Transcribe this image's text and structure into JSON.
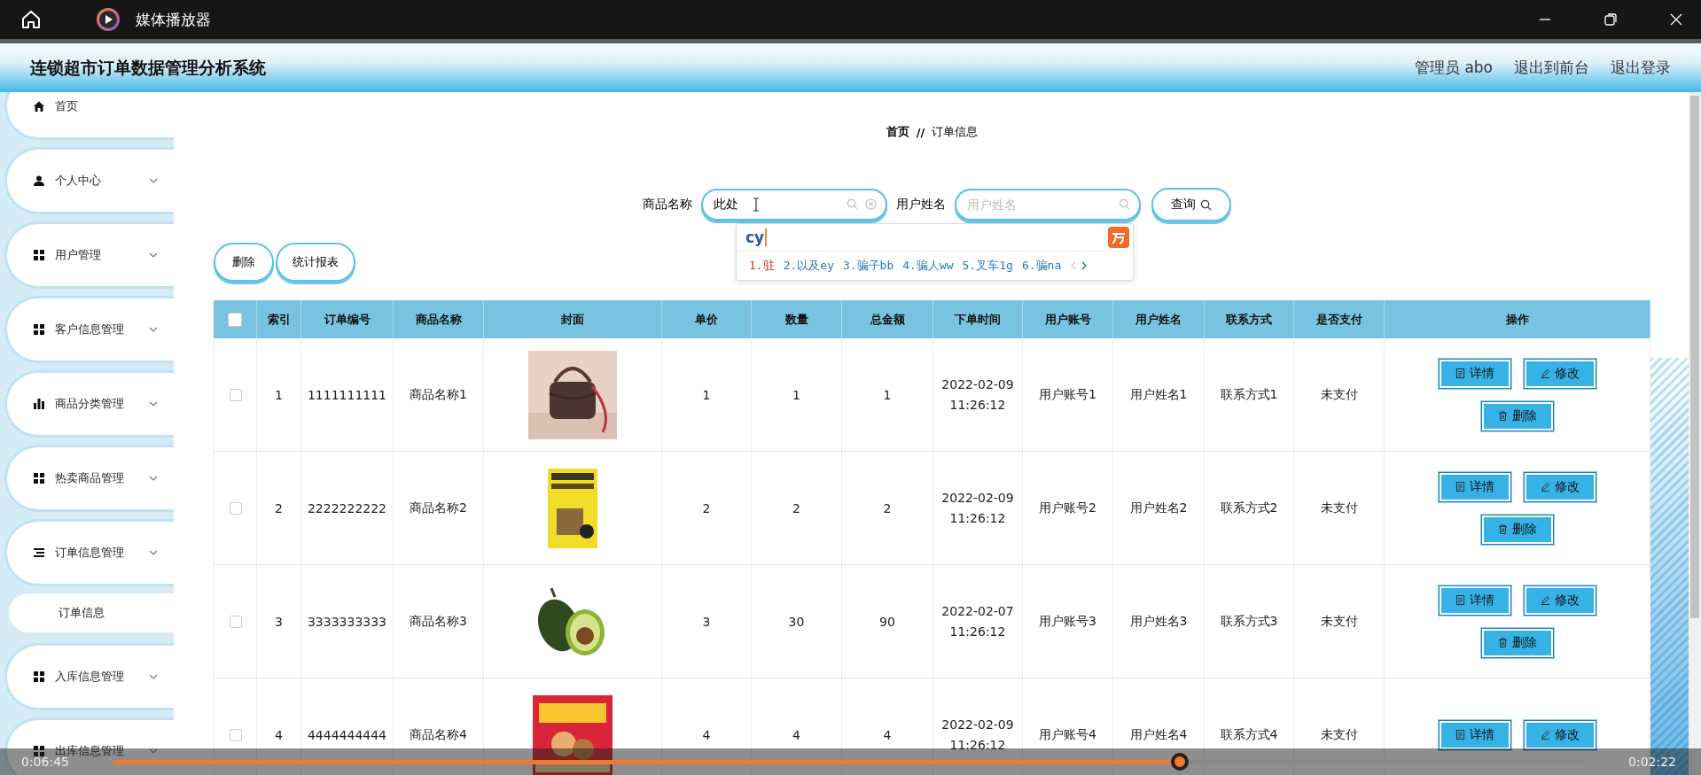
{
  "window": {
    "title": "媒体播放器"
  },
  "app": {
    "title": "连锁超市订单数据管理分析系统",
    "user": "管理员 abo",
    "links": [
      "退出到前台",
      "退出登录"
    ]
  },
  "sidebar": {
    "items": [
      {
        "label": "首页",
        "kind": "home",
        "expandable": false
      },
      {
        "label": "个人中心",
        "kind": "person",
        "expandable": true
      },
      {
        "label": "用户管理",
        "kind": "grid",
        "expandable": true
      },
      {
        "label": "客户信息管理",
        "kind": "grid",
        "expandable": true
      },
      {
        "label": "商品分类管理",
        "kind": "bars",
        "expandable": true
      },
      {
        "label": "热卖商品管理",
        "kind": "grid",
        "expandable": true
      },
      {
        "label": "订单信息管理",
        "kind": "list",
        "expandable": true,
        "children": [
          {
            "label": "订单信息"
          }
        ]
      },
      {
        "label": "入库信息管理",
        "kind": "grid",
        "expandable": true
      },
      {
        "label": "出库信息管理",
        "kind": "grid",
        "expandable": true
      }
    ]
  },
  "breadcrumb": {
    "items": [
      "首页",
      "订单信息"
    ],
    "separator": "//"
  },
  "search": {
    "fields": [
      {
        "label": "商品名称",
        "value": "此处",
        "clearable": true
      },
      {
        "label": "用户姓名",
        "placeholder": "用户姓名",
        "clearable": false
      }
    ],
    "button": "查询"
  },
  "ime": {
    "input": "cy",
    "candidates": [
      {
        "text": "1.驻",
        "selected": true
      },
      {
        "text": "2.以及ey",
        "selected": false
      },
      {
        "text": "3.骗子bb",
        "selected": false
      },
      {
        "text": "4.骗人ww",
        "selected": false
      },
      {
        "text": "5.叉车1g",
        "selected": false
      },
      {
        "text": "6.骗na",
        "selected": false
      }
    ]
  },
  "toolbar": [
    "删除",
    "统计报表"
  ],
  "table": {
    "all_checked": false,
    "columns": [
      "索引",
      "订单编号",
      "商品名称",
      "封面",
      "单价",
      "数量",
      "总金额",
      "下单时间",
      "用户账号",
      "用户姓名",
      "联系方式",
      "是否支付",
      "操作"
    ],
    "rows": [
      {
        "checked": false,
        "cells": [
          "1",
          "1111111111",
          "商品名称1",
          "",
          "1",
          "1",
          "1",
          "2022-02-09 11:26:12",
          "用户账号1",
          "用户姓名1",
          "联系方式1",
          "未支付"
        ],
        "cover": {
          "kind": "picture"
        },
        "actions": [
          {
            "kind": "detail",
            "label": "详情"
          },
          {
            "kind": "edit",
            "label": "修改"
          },
          {
            "kind": "delete",
            "label": "删除"
          }
        ]
      },
      {
        "checked": false,
        "cells": [
          "2",
          "2222222222",
          "商品名称2",
          "",
          "2",
          "2",
          "2",
          "2022-02-09 11:26:12",
          "用户账号2",
          "用户姓名2",
          "联系方式2",
          "未支付"
        ],
        "cover": {
          "kind": "picture"
        },
        "actions": [
          {
            "kind": "detail",
            "label": "详情"
          },
          {
            "kind": "edit",
            "label": "修改"
          },
          {
            "kind": "delete",
            "label": "删除"
          }
        ]
      },
      {
        "checked": false,
        "cells": [
          "3",
          "3333333333",
          "商品名称3",
          "",
          "3",
          "30",
          "90",
          "2022-02-07 11:26:12",
          "用户账号3",
          "用户姓名3",
          "联系方式3",
          "未支付"
        ],
        "cover": {
          "kind": "picture"
        },
        "actions": [
          {
            "kind": "detail",
            "label": "详情"
          },
          {
            "kind": "edit",
            "label": "修改"
          },
          {
            "kind": "delete",
            "label": "删除"
          }
        ]
      },
      {
        "checked": false,
        "cells": [
          "4",
          "4444444444",
          "商品名称4",
          "",
          "4",
          "4",
          "4",
          "2022-02-09 11:26:12",
          "用户账号4",
          "用户姓名4",
          "联系方式4",
          "未支付"
        ],
        "cover": {
          "kind": "picture"
        },
        "actions": [
          {
            "kind": "detail",
            "label": "详情"
          },
          {
            "kind": "edit",
            "label": "修改"
          }
        ]
      }
    ]
  },
  "player": {
    "elapsed": "0:06:45",
    "remaining": "0:02:22",
    "level": 0.725
  }
}
